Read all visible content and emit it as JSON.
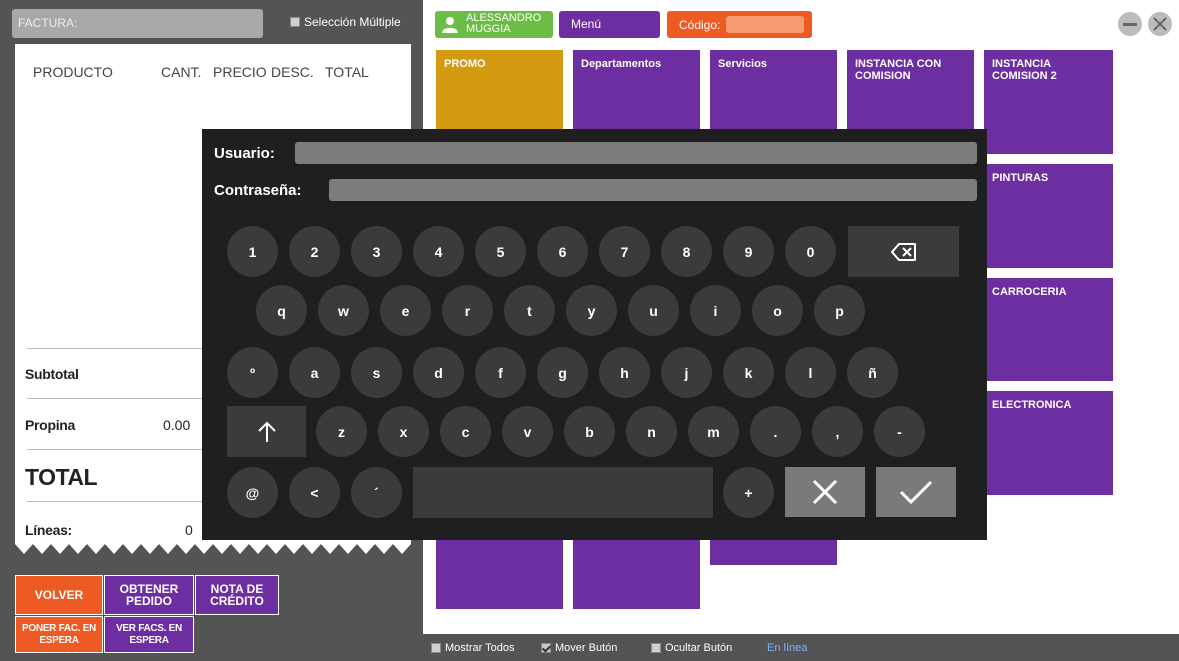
{
  "invoice": {
    "factura_label": "FACTURA:",
    "multi_select_label": "Selección Múltiple",
    "columns": [
      "PRODUCTO",
      "CANT.",
      "PRECIO",
      "DESC.",
      "TOTAL"
    ],
    "subtotal_label": "Subtotal",
    "propina_label": "Propina",
    "propina_value": "0.00",
    "total_label": "TOTAL",
    "lineas_label": "Líneas:",
    "lineas_value": "0"
  },
  "left_buttons": {
    "volver": "VOLVER",
    "obtener_pedido": "OBTENER PEDIDO",
    "nota_credito": "NOTA DE CRÉDITO",
    "poner_espera": "PONER FAC. EN ESPERA",
    "ver_espera": "VER FACS. EN ESPERA"
  },
  "topbar": {
    "user_name": "ALESSANDRO MUGGIA",
    "menu_label": "Menú",
    "codigo_label": "Código:"
  },
  "tiles": {
    "t1": "PROMO",
    "t2": "Departamentos",
    "t3": "Servicios",
    "t4": "INSTANCIA CON COMISION",
    "t5": "INSTANCIA COMISION 2",
    "t6": "PINTURAS",
    "t7": "CARROCERIA",
    "t8": "ELECTRONICA"
  },
  "bottom_bar": {
    "mostrar_todos": "Mostrar Todos",
    "mover_boton": "Mover Butón",
    "ocultar_boton": "Ocultar Butón",
    "status": "En línea"
  },
  "keyboard": {
    "usuario_label": "Usuario:",
    "password_label": "Contraseña:",
    "row1": [
      "1",
      "2",
      "3",
      "4",
      "5",
      "6",
      "7",
      "8",
      "9",
      "0"
    ],
    "row2": [
      "q",
      "w",
      "e",
      "r",
      "t",
      "y",
      "u",
      "i",
      "o",
      "p"
    ],
    "row3": [
      "º",
      "a",
      "s",
      "d",
      "f",
      "g",
      "h",
      "j",
      "k",
      "l",
      "ñ"
    ],
    "row4": [
      "z",
      "x",
      "c",
      "v",
      "b",
      "n",
      "m",
      ".",
      ",",
      "-"
    ],
    "row5": [
      "@",
      "<",
      "´"
    ],
    "plus": "+",
    "shift_icon": "arrow-up-icon",
    "backspace_icon": "backspace-icon",
    "cancel_icon": "close-icon",
    "confirm_icon": "checkmark-icon"
  },
  "colors": {
    "purple": "#6c2ea0",
    "orange": "#ee5a24",
    "green": "#6bbd45",
    "gold": "#d49a12",
    "dark_panel": "#545454",
    "keyboard_bg": "#1f1f1f",
    "status_blue": "#7fb2ff"
  }
}
